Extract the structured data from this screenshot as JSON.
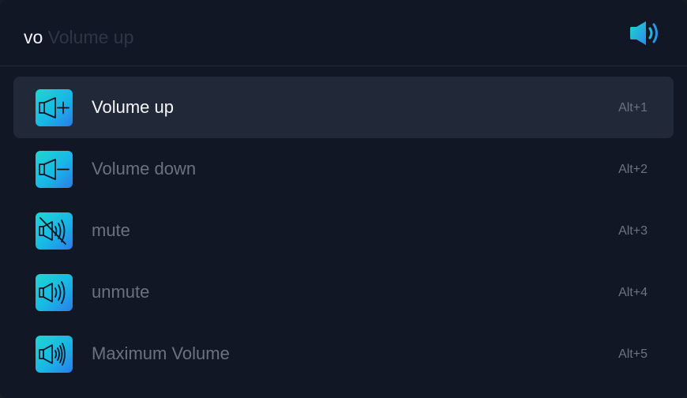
{
  "search": {
    "typed": "vo",
    "suggestion": " Volume up",
    "icon": "speaker-icon"
  },
  "accent": {
    "gradient_start": "#1fd6cf",
    "gradient_end": "#2a7ce9",
    "selected_bg": "#212938"
  },
  "results": [
    {
      "label": "Volume up",
      "shortcut": "Alt+1",
      "icon": "volume-up-icon",
      "selected": true
    },
    {
      "label": "Volume down",
      "shortcut": "Alt+2",
      "icon": "volume-down-icon",
      "selected": false
    },
    {
      "label": "mute",
      "shortcut": "Alt+3",
      "icon": "mute-icon",
      "selected": false
    },
    {
      "label": "unmute",
      "shortcut": "Alt+4",
      "icon": "unmute-icon",
      "selected": false
    },
    {
      "label": "Maximum Volume",
      "shortcut": "Alt+5",
      "icon": "max-volume-icon",
      "selected": false
    }
  ]
}
